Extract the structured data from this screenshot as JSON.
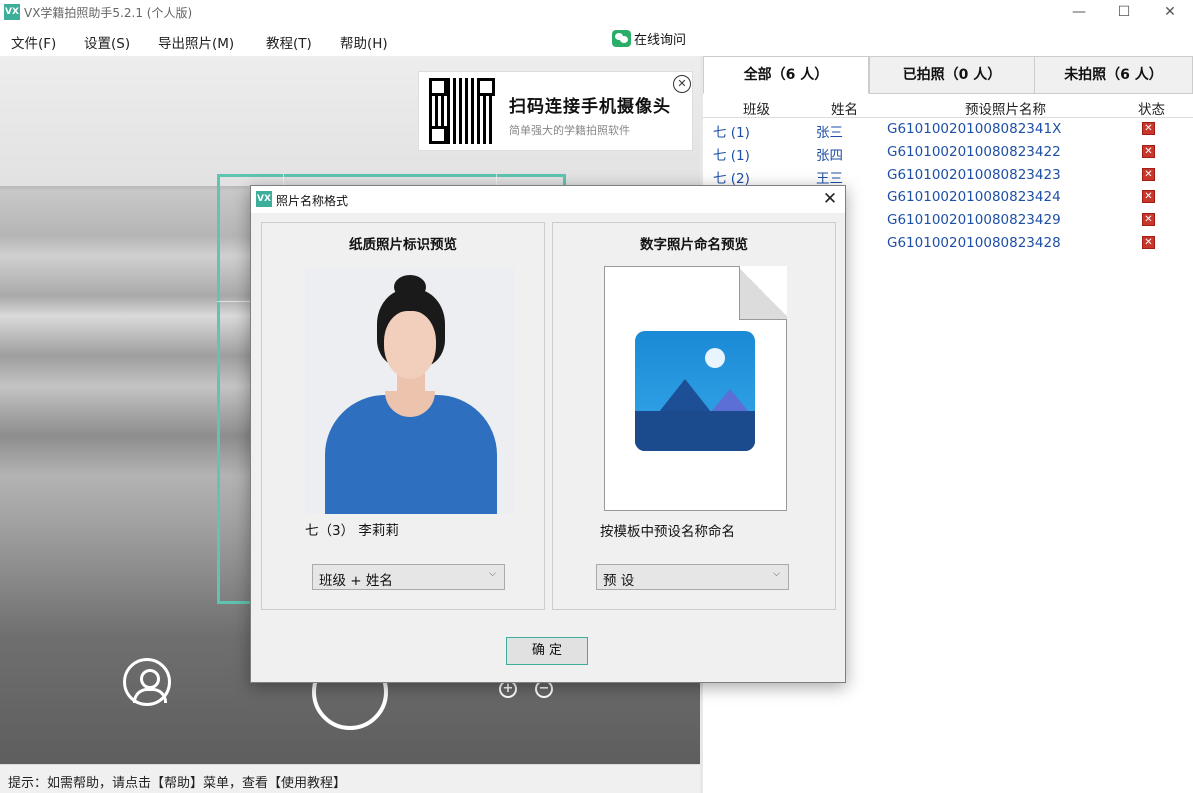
{
  "window": {
    "title": "VX学籍拍照助手5.2.1 (个人版)",
    "icon_text": "VX",
    "minimize": "—",
    "maximize": "☐",
    "close": "✕"
  },
  "menu": [
    "文件(F)",
    "设置(S)",
    "导出照片(M)",
    "教程(T)",
    "帮助(H)"
  ],
  "online_help": "在线询问",
  "qr_card": {
    "title": "扫码连接手机摄像头",
    "subtitle": "简单强大的学籍拍照软件",
    "close": "✕"
  },
  "camera": {
    "zoom_in": "+",
    "zoom_out": "−"
  },
  "status_bar": "提示：如需帮助，请点击【帮助】菜单，查看【使用教程】",
  "tabs": [
    "全部（6 人）",
    "已拍照（0 人）",
    "未拍照（6 人）"
  ],
  "table": {
    "headers": [
      "班级",
      "姓名",
      "预设照片名称",
      "状态"
    ],
    "rows": [
      {
        "class": "七 (1)",
        "name": "张三",
        "preset": "G610100201008082341X",
        "status": "✕"
      },
      {
        "class": "七 (1)",
        "name": "张四",
        "preset": "G6101002010080823422",
        "status": "✕"
      },
      {
        "class": "七 (2)",
        "name": "王三",
        "preset": "G6101002010080823423",
        "status": "✕"
      },
      {
        "class": "",
        "name": "",
        "preset": "G6101002010080823424",
        "status": "✕"
      },
      {
        "class": "",
        "name": "",
        "preset": "G6101002010080823429",
        "status": "✕"
      },
      {
        "class": "",
        "name": "",
        "preset": "G6101002010080823428",
        "status": "✕"
      }
    ]
  },
  "dialog": {
    "title": "照片名称格式",
    "close": "✕",
    "left": {
      "title": "纸质照片标识预览",
      "caption": "七（3） 李莉莉",
      "select_value": "班级 + 姓名"
    },
    "right": {
      "title": "数字照片命名预览",
      "caption": "按模板中预设名称命名",
      "select_value": "预 设"
    },
    "ok": "确 定"
  }
}
